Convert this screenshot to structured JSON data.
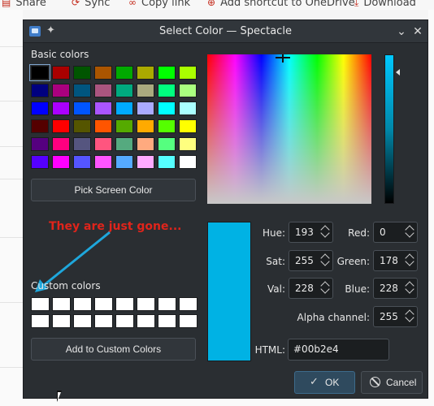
{
  "background_toolbar": {
    "items": [
      {
        "label": "Share",
        "icon": "share-icon"
      },
      {
        "label": "Sync",
        "icon": "sync-icon"
      },
      {
        "label": "Copy link",
        "icon": "link-icon"
      },
      {
        "label": "Add shortcut to OneDrive",
        "icon": "shortcut-icon"
      },
      {
        "label": "Download",
        "icon": "download-icon"
      }
    ]
  },
  "dialog": {
    "title": "Select Color — Spectacle",
    "basic_colors_label": "Basic colors",
    "basic_colors": [
      "#000000",
      "#aa0000",
      "#005500",
      "#aa5500",
      "#00aa00",
      "#aaaa00",
      "#00ff00",
      "#aaff00",
      "#00007f",
      "#aa007f",
      "#00557f",
      "#aa557f",
      "#00aa7f",
      "#aaaa7f",
      "#00ff7f",
      "#aaff7f",
      "#0000ff",
      "#aa00ff",
      "#0055ff",
      "#aa55ff",
      "#00aaff",
      "#aaaaff",
      "#00ffff",
      "#aaffff",
      "#550000",
      "#ff0000",
      "#555500",
      "#ff5500",
      "#55aa00",
      "#ffaa00",
      "#55ff00",
      "#ffff00",
      "#55007f",
      "#ff007f",
      "#55557f",
      "#ff557f",
      "#55aa7f",
      "#ffaa7f",
      "#55ff7f",
      "#ffff7f",
      "#5500ff",
      "#ff00ff",
      "#5555ff",
      "#ff55ff",
      "#55aaff",
      "#ffaaff",
      "#55ffff",
      "#ffffff"
    ],
    "pick_screen_label": "Pick Screen Color",
    "annotation": "They are just gone...",
    "custom_colors_label": "Custom colors",
    "custom_colors": [
      "#ffffff",
      "#ffffff",
      "#ffffff",
      "#ffffff",
      "#ffffff",
      "#ffffff",
      "#ffffff",
      "#ffffff",
      "#ffffff",
      "#ffffff",
      "#ffffff",
      "#ffffff",
      "#ffffff",
      "#ffffff",
      "#ffffff",
      "#ffffff"
    ],
    "add_custom_label": "Add to Custom Colors",
    "current_color": "#00b2e4",
    "fields": {
      "hue_label": "Hue:",
      "hue": "193",
      "sat_label": "Sat:",
      "sat": "255",
      "val_label": "Val:",
      "val": "228",
      "red_label": "Red:",
      "red": "0",
      "green_label": "Green:",
      "green": "178",
      "blue_label": "Blue:",
      "blue": "228",
      "alpha_label": "Alpha channel:",
      "alpha": "255",
      "html_label": "HTML:",
      "html": "#00b2e4"
    },
    "ok_label": "OK",
    "cancel_label": "Cancel",
    "colors": {
      "bg": "#2a2e32",
      "titlebar": "#31363b",
      "accent": "#3d6b8c",
      "annotation": "#e0241b",
      "arrow": "#1ea7dc"
    }
  }
}
